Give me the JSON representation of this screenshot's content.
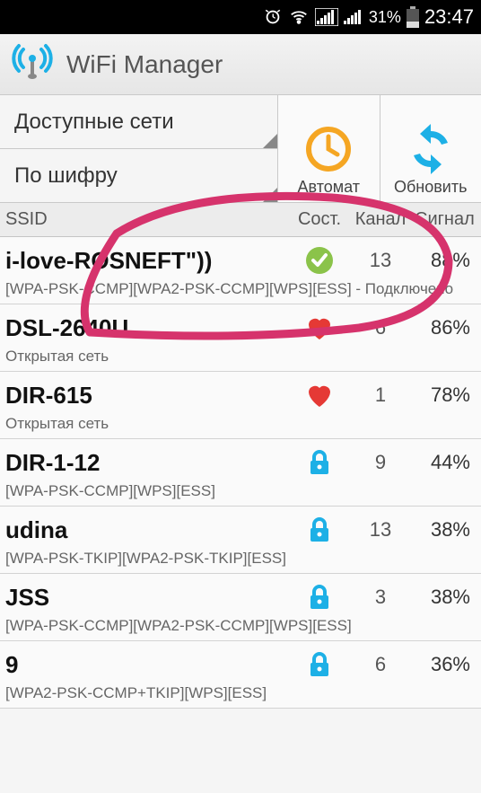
{
  "status_bar": {
    "battery_pct": "31%",
    "clock": "23:47"
  },
  "header": {
    "title": "WiFi Manager"
  },
  "tabs": {
    "networks": "Доступные сети",
    "encryption": "По шифру"
  },
  "actions": {
    "auto": "Автомат",
    "refresh": "Обновить"
  },
  "table_header": {
    "ssid": "SSID",
    "status": "Сост.",
    "channel": "Канал",
    "signal": "Сигнал"
  },
  "networks": [
    {
      "ssid": "i-love-ROSNEFT\"))",
      "status_icon": "check",
      "channel": "13",
      "signal": "88%",
      "detail": "[WPA-PSK-CCMP][WPA2-PSK-CCMP][WPS][ESS] - Подключено"
    },
    {
      "ssid": "DSL-2640U",
      "status_icon": "heart",
      "channel": "6",
      "signal": "86%",
      "detail": "Открытая сеть"
    },
    {
      "ssid": "DIR-615",
      "status_icon": "heart",
      "channel": "1",
      "signal": "78%",
      "detail": "Открытая сеть"
    },
    {
      "ssid": "DIR-1-12",
      "status_icon": "lock",
      "channel": "9",
      "signal": "44%",
      "detail": "[WPA-PSK-CCMP][WPS][ESS]"
    },
    {
      "ssid": "udina",
      "status_icon": "lock",
      "channel": "13",
      "signal": "38%",
      "detail": "[WPA-PSK-TKIP][WPA2-PSK-TKIP][ESS]"
    },
    {
      "ssid": "JSS",
      "status_icon": "lock",
      "channel": "3",
      "signal": "38%",
      "detail": "[WPA-PSK-CCMP][WPA2-PSK-CCMP][WPS][ESS]"
    },
    {
      "ssid": "9",
      "status_icon": "lock",
      "channel": "6",
      "signal": "36%",
      "detail": "[WPA2-PSK-CCMP+TKIP][WPS][ESS]"
    }
  ],
  "colors": {
    "accent_orange": "#f5a623",
    "accent_blue": "#1db0e6",
    "check_green": "#8bc34a",
    "heart_red": "#e53935",
    "annotation": "#d6336c"
  }
}
